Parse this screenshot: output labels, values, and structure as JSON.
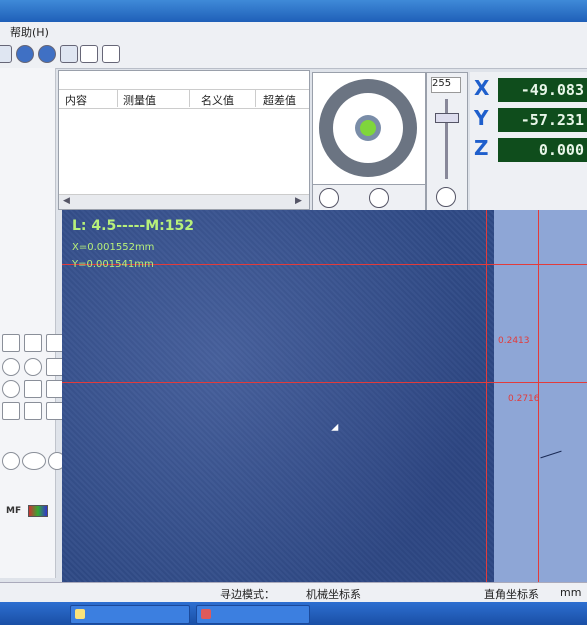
{
  "menu": {
    "help": "帮助(H)"
  },
  "table": {
    "columns": [
      "内容",
      "测量值",
      "名义值",
      "超差值"
    ]
  },
  "slider": {
    "value": "255"
  },
  "dro": {
    "x_label": "X",
    "x_value": "-49.083",
    "y_label": "Y",
    "y_value": "-57.231",
    "z_label": "Z",
    "z_value": "0.000"
  },
  "camera": {
    "hud_line1": "L: 4.5-----M:152",
    "hud_line2": "X=0.001552mm",
    "hud_line3": "Y=0.001541mm",
    "tag1": "0.2413",
    "tag2": "0.2716"
  },
  "left_panel": {
    "mf_label": "MF"
  },
  "status": {
    "mode": "寻边模式：",
    "coord_system": "机械坐标系",
    "rect_system": "直角坐标系",
    "unit": "mm"
  },
  "colors": {
    "dro_bg": "#0f4d1c",
    "axis_label": "#1f5fcc",
    "hud_text": "#b7f07a",
    "crosshair": "#e23b3b",
    "camera_bg": "#2f4a86"
  }
}
